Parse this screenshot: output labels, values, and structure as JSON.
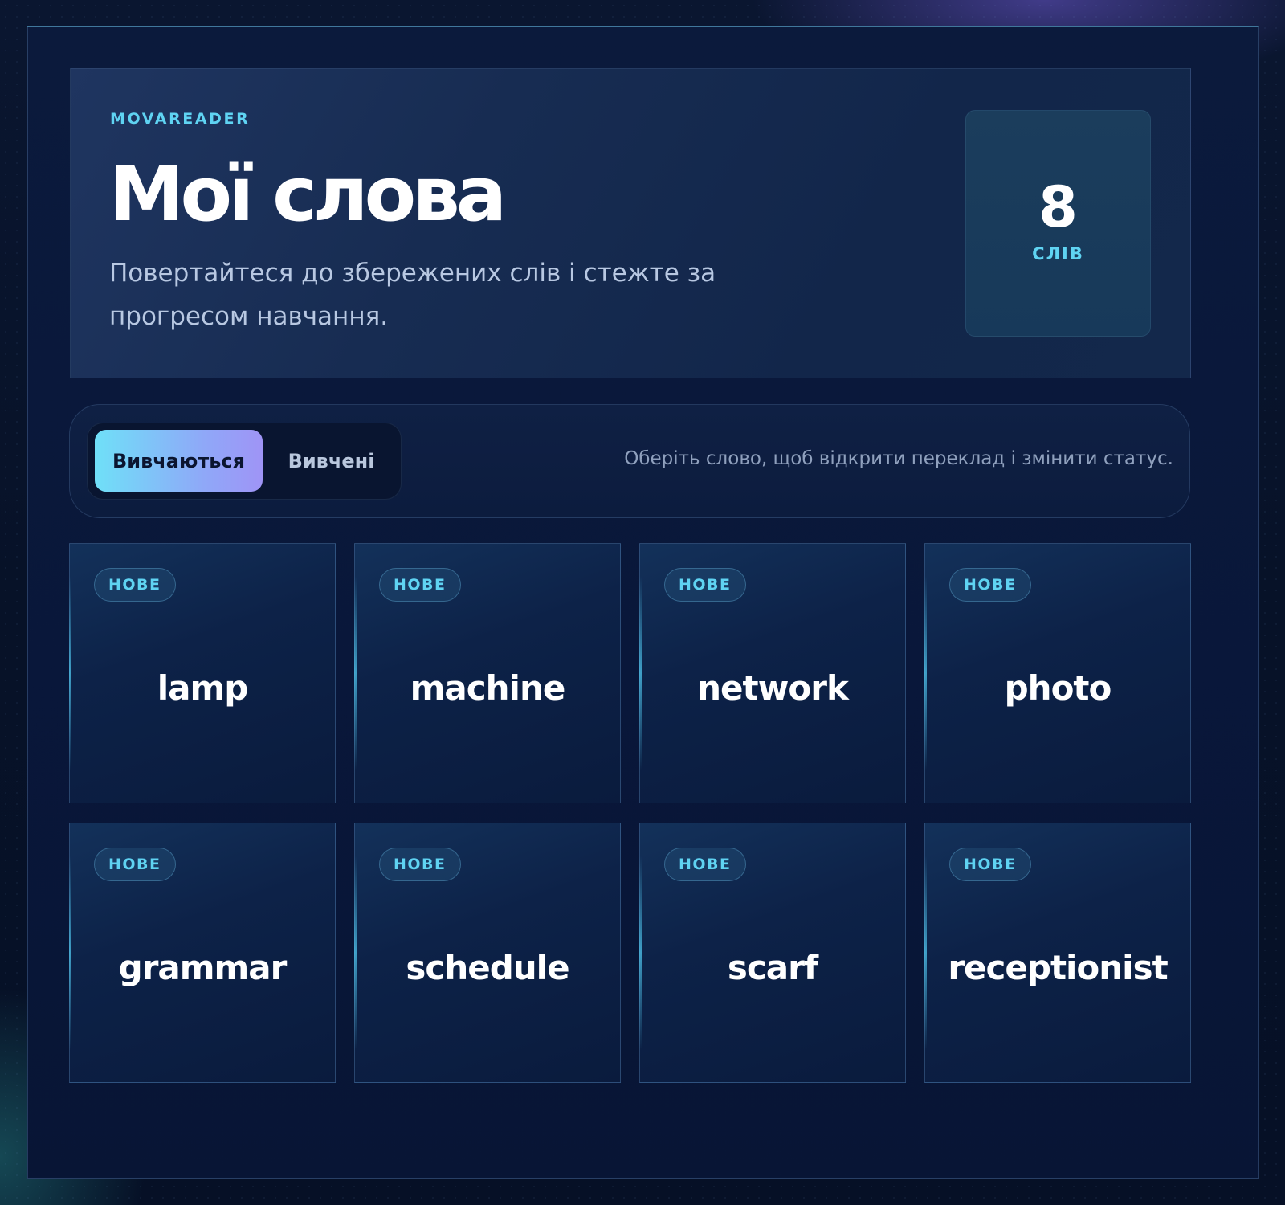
{
  "header": {
    "brand": "MOVAREADER",
    "title": "Мої слова",
    "subtitle": "Повертайтеся до збережених слів і стежте за прогресом навчання."
  },
  "stats": {
    "count": "8",
    "count_label": "СЛІВ"
  },
  "filters": {
    "tabs": [
      {
        "label": "Вивчаються",
        "active": true
      },
      {
        "label": "Вивчені",
        "active": false
      }
    ],
    "hint": "Оберіть слово, щоб відкрити переклад і змінити статус."
  },
  "words": [
    {
      "word": "lamp",
      "status": "НОВЕ"
    },
    {
      "word": "machine",
      "status": "НОВЕ"
    },
    {
      "word": "network",
      "status": "НОВЕ"
    },
    {
      "word": "photo",
      "status": "НОВЕ"
    },
    {
      "word": "grammar",
      "status": "НОВЕ"
    },
    {
      "word": "schedule",
      "status": "НОВЕ"
    },
    {
      "word": "scarf",
      "status": "НОВЕ"
    },
    {
      "word": "receptionist",
      "status": "НОВЕ"
    }
  ],
  "colors": {
    "accent": "#5fd3f2",
    "active_tab_gradient_start": "#6fe0f8",
    "active_tab_gradient_end": "#9f94f6",
    "background": "#081535"
  }
}
